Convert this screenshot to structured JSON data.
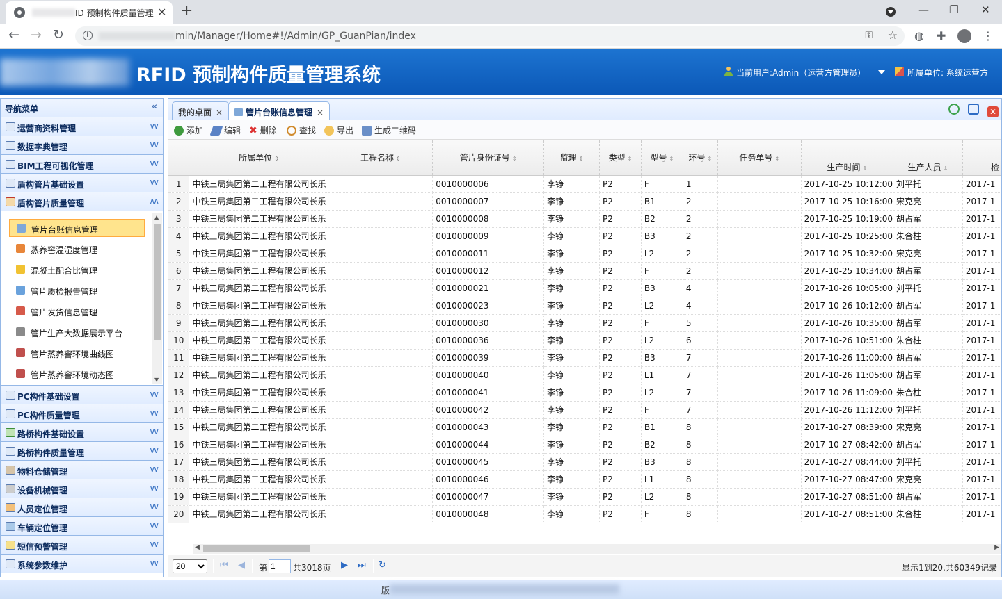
{
  "browser": {
    "tab_title": "ID 预制构件质量管理",
    "url": "min/Manager/Home#!/Admin/GP_GuanPian/index"
  },
  "header": {
    "system_title": "RFID 预制构件质量管理系统",
    "current_user": "当前用户:Admin（运营方管理员）",
    "org": "所属单位: 系统运营方"
  },
  "sidebar": {
    "title": "导航菜单",
    "groups_top": [
      {
        "label": "运营商资料管理"
      },
      {
        "label": "数据字典管理"
      },
      {
        "label": "BIM工程可视化管理"
      },
      {
        "label": "盾构管片基础设置"
      },
      {
        "label": "盾构管片质量管理"
      }
    ],
    "sub_items": [
      {
        "label": "管片台账信息管理",
        "color": "#7fa8d8"
      },
      {
        "label": "蒸养窖温湿度管理",
        "color": "#e8863a"
      },
      {
        "label": "混凝土配合比管理",
        "color": "#f1c232"
      },
      {
        "label": "管片质检报告管理",
        "color": "#6aa2dc"
      },
      {
        "label": "管片发货信息管理",
        "color": "#d65a4a"
      },
      {
        "label": "管片生产大数据展示平台",
        "color": "#8a8a8a"
      },
      {
        "label": "管片蒸养窨环境曲线图",
        "color": "#c0504d"
      },
      {
        "label": "管片蒸养窨环境动态图",
        "color": "#c0504d"
      }
    ],
    "groups_bottom": [
      {
        "label": "PC构件基础设置"
      },
      {
        "label": "PC构件质量管理"
      },
      {
        "label": "路桥构件基础设置"
      },
      {
        "label": "路桥构件质量管理"
      },
      {
        "label": "物料仓储管理"
      },
      {
        "label": "设备机械管理"
      },
      {
        "label": "人员定位管理"
      },
      {
        "label": "车辆定位管理"
      },
      {
        "label": "短信预警管理"
      },
      {
        "label": "系统参数维护"
      }
    ]
  },
  "tabs": [
    {
      "label": "我的桌面"
    },
    {
      "label": "管片台账信息管理"
    }
  ],
  "toolbar": {
    "add": "添加",
    "edit": "编辑",
    "delete": "删除",
    "find": "查找",
    "export": "导出",
    "qrcode": "生成二维码"
  },
  "grid": {
    "columns": [
      "所属单位",
      "工程名称",
      "管片身份证号",
      "监理",
      "类型",
      "型号",
      "环号",
      "任务单号",
      "生产时间",
      "生产人员",
      "检"
    ],
    "rows": [
      [
        "1",
        "中铁三局集团第二工程有限公司长乐",
        "",
        "0010000006",
        "李铮",
        "P2",
        "F",
        "1",
        "",
        "2017-10-25 10:12:00",
        "刘平托",
        "2017-1"
      ],
      [
        "2",
        "中铁三局集团第二工程有限公司长乐",
        "",
        "0010000007",
        "李铮",
        "P2",
        "B1",
        "2",
        "",
        "2017-10-25 10:16:00",
        "宋克亮",
        "2017-1"
      ],
      [
        "3",
        "中铁三局集团第二工程有限公司长乐",
        "",
        "0010000008",
        "李铮",
        "P2",
        "B2",
        "2",
        "",
        "2017-10-25 10:19:00",
        "胡占军",
        "2017-1"
      ],
      [
        "4",
        "中铁三局集团第二工程有限公司长乐",
        "",
        "0010000009",
        "李铮",
        "P2",
        "B3",
        "2",
        "",
        "2017-10-25 10:25:00",
        "朱合柱",
        "2017-1"
      ],
      [
        "5",
        "中铁三局集团第二工程有限公司长乐",
        "",
        "0010000011",
        "李铮",
        "P2",
        "L2",
        "2",
        "",
        "2017-10-25 10:32:00",
        "宋克亮",
        "2017-1"
      ],
      [
        "6",
        "中铁三局集团第二工程有限公司长乐",
        "",
        "0010000012",
        "李铮",
        "P2",
        "F",
        "2",
        "",
        "2017-10-25 10:34:00",
        "胡占军",
        "2017-1"
      ],
      [
        "7",
        "中铁三局集团第二工程有限公司长乐",
        "",
        "0010000021",
        "李铮",
        "P2",
        "B3",
        "4",
        "",
        "2017-10-26 10:05:00",
        "刘平托",
        "2017-1"
      ],
      [
        "8",
        "中铁三局集团第二工程有限公司长乐",
        "",
        "0010000023",
        "李铮",
        "P2",
        "L2",
        "4",
        "",
        "2017-10-26 10:12:00",
        "胡占军",
        "2017-1"
      ],
      [
        "9",
        "中铁三局集团第二工程有限公司长乐",
        "",
        "0010000030",
        "李铮",
        "P2",
        "F",
        "5",
        "",
        "2017-10-26 10:35:00",
        "胡占军",
        "2017-1"
      ],
      [
        "10",
        "中铁三局集团第二工程有限公司长乐",
        "",
        "0010000036",
        "李铮",
        "P2",
        "L2",
        "6",
        "",
        "2017-10-26 10:51:00",
        "朱合柱",
        "2017-1"
      ],
      [
        "11",
        "中铁三局集团第二工程有限公司长乐",
        "",
        "0010000039",
        "李铮",
        "P2",
        "B3",
        "7",
        "",
        "2017-10-26 11:00:00",
        "胡占军",
        "2017-1"
      ],
      [
        "12",
        "中铁三局集团第二工程有限公司长乐",
        "",
        "0010000040",
        "李铮",
        "P2",
        "L1",
        "7",
        "",
        "2017-10-26 11:05:00",
        "胡占军",
        "2017-1"
      ],
      [
        "13",
        "中铁三局集团第二工程有限公司长乐",
        "",
        "0010000041",
        "李铮",
        "P2",
        "L2",
        "7",
        "",
        "2017-10-26 11:09:00",
        "朱合柱",
        "2017-1"
      ],
      [
        "14",
        "中铁三局集团第二工程有限公司长乐",
        "",
        "0010000042",
        "李铮",
        "P2",
        "F",
        "7",
        "",
        "2017-10-26 11:12:00",
        "刘平托",
        "2017-1"
      ],
      [
        "15",
        "中铁三局集团第二工程有限公司长乐",
        "",
        "0010000043",
        "李铮",
        "P2",
        "B1",
        "8",
        "",
        "2017-10-27 08:39:00",
        "宋克亮",
        "2017-1"
      ],
      [
        "16",
        "中铁三局集团第二工程有限公司长乐",
        "",
        "0010000044",
        "李铮",
        "P2",
        "B2",
        "8",
        "",
        "2017-10-27 08:42:00",
        "胡占军",
        "2017-1"
      ],
      [
        "17",
        "中铁三局集团第二工程有限公司长乐",
        "",
        "0010000045",
        "李铮",
        "P2",
        "B3",
        "8",
        "",
        "2017-10-27 08:44:00",
        "刘平托",
        "2017-1"
      ],
      [
        "18",
        "中铁三局集团第二工程有限公司长乐",
        "",
        "0010000046",
        "李铮",
        "P2",
        "L1",
        "8",
        "",
        "2017-10-27 08:47:00",
        "宋克亮",
        "2017-1"
      ],
      [
        "19",
        "中铁三局集团第二工程有限公司长乐",
        "",
        "0010000047",
        "李铮",
        "P2",
        "L2",
        "8",
        "",
        "2017-10-27 08:51:00",
        "胡占军",
        "2017-1"
      ],
      [
        "20",
        "中铁三局集团第二工程有限公司长乐",
        "",
        "0010000048",
        "李铮",
        "P2",
        "F",
        "8",
        "",
        "2017-10-27 08:51:00",
        "朱合柱",
        "2017-1"
      ]
    ]
  },
  "pager": {
    "page_size": "20",
    "page_prefix": "第",
    "page_value": "1",
    "page_total": "共3018页",
    "info": "显示1到20,共60349记录"
  },
  "footer": {
    "text": "版"
  }
}
